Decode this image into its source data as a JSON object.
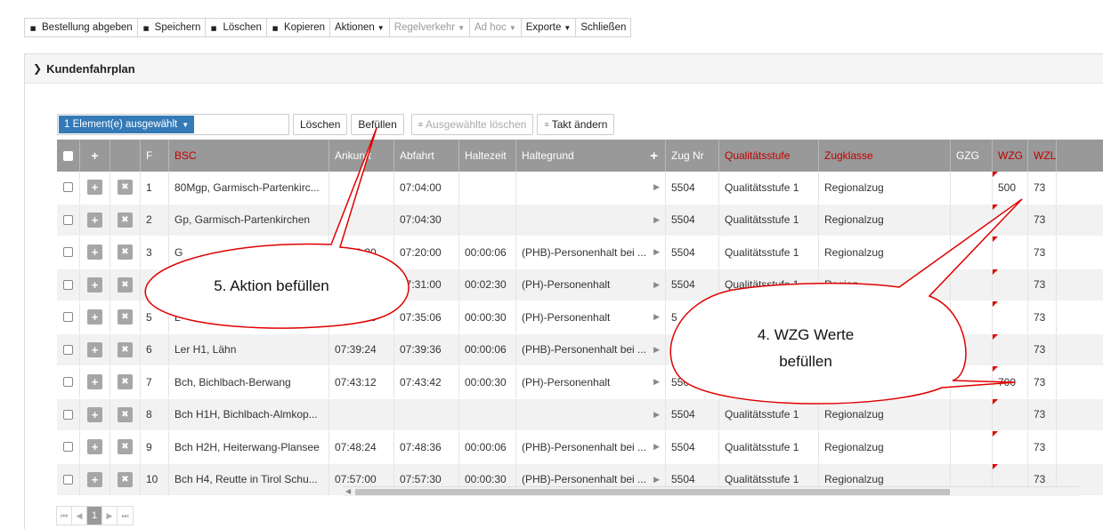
{
  "toolbar": {
    "buttons": [
      {
        "label": "Bestellung abgeben",
        "icon": "tag-icon",
        "enabled": true,
        "dropdown": false
      },
      {
        "label": "Speichern",
        "icon": "tag-icon",
        "enabled": true,
        "dropdown": false
      },
      {
        "label": "Löschen",
        "icon": "tag-icon",
        "enabled": true,
        "dropdown": false
      },
      {
        "label": "Kopieren",
        "icon": "tag-icon",
        "enabled": true,
        "dropdown": false
      },
      {
        "label": "Aktionen",
        "icon": "",
        "enabled": true,
        "dropdown": true
      },
      {
        "label": "Regelverkehr",
        "icon": "",
        "enabled": false,
        "dropdown": true
      },
      {
        "label": "Ad hoc",
        "icon": "",
        "enabled": false,
        "dropdown": true
      },
      {
        "label": "Exporte",
        "icon": "",
        "enabled": true,
        "dropdown": true
      },
      {
        "label": "Schließen",
        "icon": "",
        "enabled": true,
        "dropdown": false
      }
    ]
  },
  "panel": {
    "title": "Kundenfahrplan"
  },
  "grid_toolbar": {
    "selection": "1 Element(e) ausgewählt",
    "delete": "Löschen",
    "fill": "Befüllen",
    "delete_selected": "Ausgewählte löschen",
    "change_takt": "Takt ändern"
  },
  "columns": [
    "",
    "+",
    "",
    "F",
    "BSC",
    "Ankunft",
    "Abfahrt",
    "Haltezeit",
    "Haltegrund",
    "+",
    "Zug Nr",
    "Qualitätsstufe",
    "Zugklasse",
    "GZG",
    "WZG",
    "WZL"
  ],
  "rows": [
    {
      "f": "1",
      "bsc": "80Mgp, Garmisch-Partenkirc...",
      "an": "",
      "ab": "07:04:00",
      "hz": "",
      "hg": "",
      "zug": "5504",
      "q": "Qualitätsstufe 1",
      "zk": "Regionalzug",
      "gzg": "",
      "wzg": "500",
      "wzl": "73"
    },
    {
      "f": "2",
      "bsc": "Gp, Garmisch-Partenkirchen",
      "an": "",
      "ab": "07:04:30",
      "hz": "",
      "hg": "",
      "zug": "5504",
      "q": "Qualitätsstufe 1",
      "zk": "Regionalzug",
      "gzg": "",
      "wzg": "",
      "wzl": "73"
    },
    {
      "f": "3",
      "bsc": "G",
      "an": "07:19:30",
      "ab": "07:20:00",
      "hz": "00:00:06",
      "hg": "(PHB)-Personenhalt bei ...",
      "zug": "5504",
      "q": "Qualitätsstufe 1",
      "zk": "Regionalzug",
      "gzg": "",
      "wzg": "",
      "wzl": "73"
    },
    {
      "f": "4",
      "bsc": "",
      "an": "",
      "ab": "07:31:00",
      "hz": "00:02:30",
      "hg": "(PH)-Personenhalt",
      "zug": "5504",
      "q": "Qualitätsstufe 1",
      "zk": "Region",
      "gzg": "",
      "wzg": "",
      "wzl": "73"
    },
    {
      "f": "5",
      "bsc": "L",
      "an": "07:33:36",
      "ab": "07:35:06",
      "hz": "00:00:30",
      "hg": "(PH)-Personenhalt",
      "zug": "5",
      "q": "",
      "zk": "",
      "gzg": "",
      "wzg": "",
      "wzl": "73"
    },
    {
      "f": "6",
      "bsc": "Ler H1, Lähn",
      "an": "07:39:24",
      "ab": "07:39:36",
      "hz": "00:00:06",
      "hg": "(PHB)-Personenhalt bei ...",
      "zug": "",
      "q": "",
      "zk": "",
      "gzg": "",
      "wzg": "",
      "wzl": "73"
    },
    {
      "f": "7",
      "bsc": "Bch, Bichlbach-Berwang",
      "an": "07:43:12",
      "ab": "07:43:42",
      "hz": "00:00:30",
      "hg": "(PH)-Personenhalt",
      "zug": "550",
      "q": "",
      "zk": "",
      "gzg": "",
      "wzg": "700",
      "wzl": "73"
    },
    {
      "f": "8",
      "bsc": "Bch H1H, Bichlbach-Almkop...",
      "an": "",
      "ab": "",
      "hz": "",
      "hg": "",
      "zug": "5504",
      "q": "Qualitätsstufe 1",
      "zk": "Regionalzug",
      "gzg": "",
      "wzg": "",
      "wzl": "73"
    },
    {
      "f": "9",
      "bsc": "Bch H2H, Heiterwang-Plansee",
      "an": "07:48:24",
      "ab": "07:48:36",
      "hz": "00:00:06",
      "hg": "(PHB)-Personenhalt bei ...",
      "zug": "5504",
      "q": "Qualitätsstufe 1",
      "zk": "Regionalzug",
      "gzg": "",
      "wzg": "",
      "wzl": "73"
    },
    {
      "f": "10",
      "bsc": "Bch H4, Reutte in Tirol Schu...",
      "an": "07:57:00",
      "ab": "07:57:30",
      "hz": "00:00:30",
      "hg": "(PHB)-Personenhalt bei ...",
      "zug": "5504",
      "q": "Qualitätsstufe 1",
      "zk": "Regionalzug",
      "gzg": "",
      "wzg": "",
      "wzl": "73"
    }
  ],
  "pager": {
    "current": "1"
  },
  "callouts": {
    "fill_action": "5. Aktion befüllen",
    "wzg_line1": "4. WZG Werte",
    "wzg_line2": "befüllen"
  },
  "colors": {
    "header_bg": "#999999",
    "red_header": "#c00000",
    "selection_blue": "#337ab7",
    "callout_stroke": "#e00000"
  }
}
